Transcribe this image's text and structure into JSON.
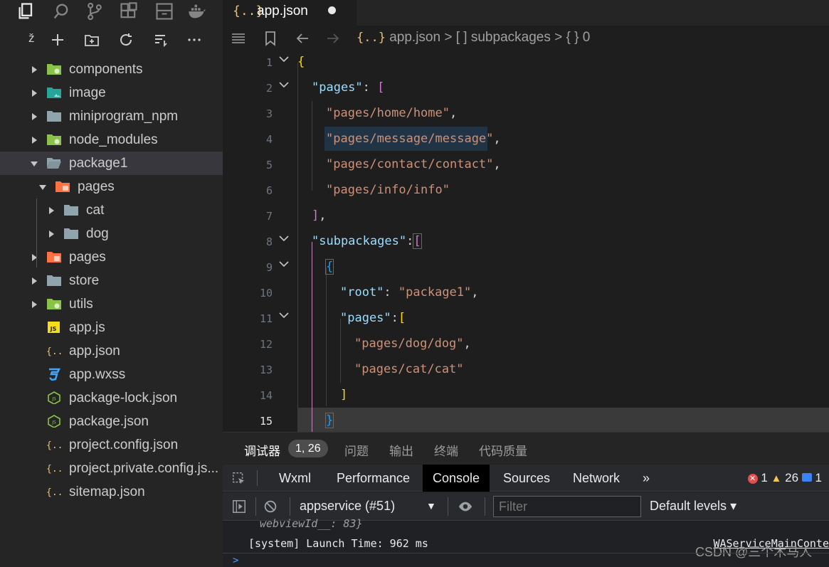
{
  "activity_bar": {
    "icons": [
      "explorer-icon",
      "search-icon",
      "source-control-icon",
      "extensions-icon",
      "panel-icon",
      "docker-icon"
    ]
  },
  "sidebar": {
    "toolbar_icons": [
      "collapse-icon",
      "new-file-icon",
      "new-folder-icon",
      "refresh-icon",
      "sort-icon",
      "more-icon"
    ],
    "tree": [
      {
        "label": "components",
        "icon": "folder-components-icon",
        "color": "#8bc34a"
      },
      {
        "label": "image",
        "icon": "folder-image-icon",
        "color": "#26a69a"
      },
      {
        "label": "miniprogram_npm",
        "icon": "folder-icon",
        "color": "#90a4ae"
      },
      {
        "label": "node_modules",
        "icon": "folder-node-icon",
        "color": "#8bc34a"
      },
      {
        "label": "package1",
        "icon": "folder-open-icon",
        "color": "#90a4ae"
      },
      {
        "label": "pages",
        "icon": "folder-pages-icon",
        "color": "#ff7043"
      },
      {
        "label": "cat",
        "icon": "folder-icon",
        "color": "#90a4ae"
      },
      {
        "label": "dog",
        "icon": "folder-icon",
        "color": "#90a4ae"
      },
      {
        "label": "pages",
        "icon": "folder-pages-icon",
        "color": "#ff7043"
      },
      {
        "label": "store",
        "icon": "folder-icon",
        "color": "#90a4ae"
      },
      {
        "label": "utils",
        "icon": "folder-utils-icon",
        "color": "#8bc34a"
      },
      {
        "label": "app.js",
        "icon": "js-icon",
        "color": "#f5de19"
      },
      {
        "label": "app.json",
        "icon": "json-icon",
        "color": "#e5c07b"
      },
      {
        "label": "app.wxss",
        "icon": "css-icon",
        "color": "#42a5f5"
      },
      {
        "label": "package-lock.json",
        "icon": "nodejs-icon",
        "color": "#8bc34a"
      },
      {
        "label": "package.json",
        "icon": "nodejs-icon",
        "color": "#8bc34a"
      },
      {
        "label": "project.config.json",
        "icon": "json-icon",
        "color": "#e5c07b"
      },
      {
        "label": "project.private.config.js...",
        "icon": "json-icon",
        "color": "#e5c07b"
      },
      {
        "label": "sitemap.json",
        "icon": "json-icon",
        "color": "#e5c07b"
      }
    ]
  },
  "editor": {
    "tab": {
      "label": "app.json",
      "icon_text": "{..}"
    },
    "breadcrumb": {
      "file_icon": "{..}",
      "file": "app.json",
      "sep": ">",
      "crumb2": "[ ] subpackages",
      "crumb3": "{ } 0"
    },
    "line_numbers": [
      "1",
      "2",
      "3",
      "4",
      "5",
      "6",
      "7",
      "8",
      "9",
      "10",
      "11",
      "12",
      "13",
      "14",
      "15"
    ]
  },
  "panel": {
    "tabs": [
      "调试器",
      "问题",
      "输出",
      "终端",
      "代码质量"
    ],
    "badge": "1, 26",
    "devtools_tabs": [
      "Wxml",
      "Performance",
      "Console",
      "Sources",
      "Network",
      "»"
    ],
    "counts": {
      "errors": "1",
      "warnings": "26",
      "info": "1"
    },
    "context": "appservice (#51)",
    "filter_placeholder": "Filter",
    "levels": "Default levels",
    "truncated_line": "webviewId__: 83}",
    "log_line": "[system] Launch Time: 962 ms",
    "log_source": "WAServiceMainConte",
    "prompt": ">",
    "watermark": "CSDN @三个木马人"
  }
}
